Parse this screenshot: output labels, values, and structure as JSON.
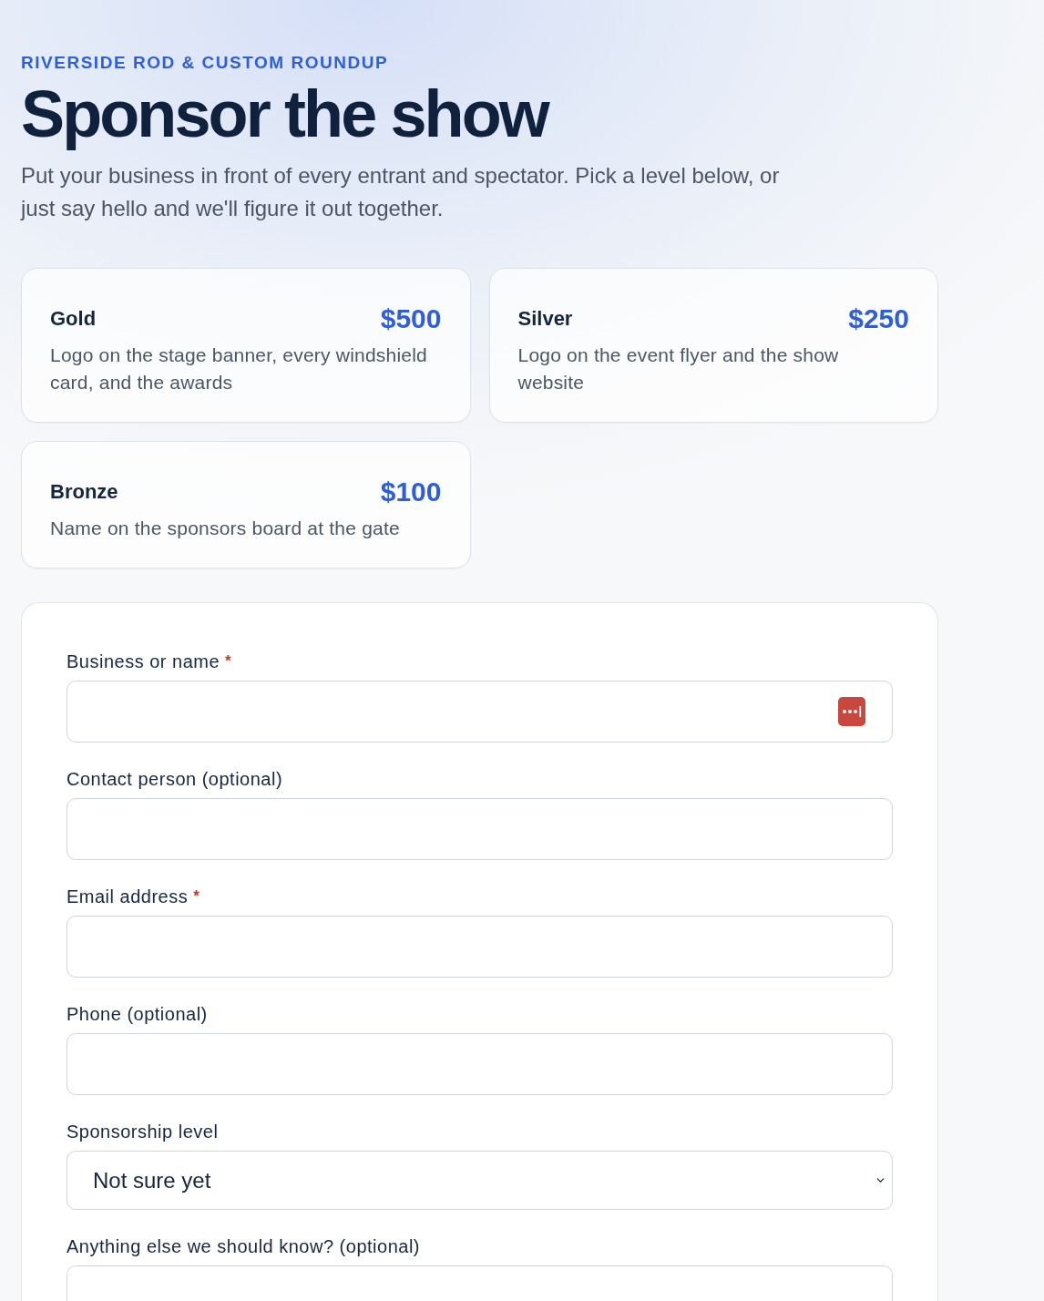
{
  "header": {
    "eyebrow": "RIVERSIDE ROD & CUSTOM ROUNDUP",
    "title": "Sponsor the show",
    "intro": "Put your business in front of every entrant and spectator. Pick a level below, or just say hello and we'll figure it out together."
  },
  "tiers": [
    {
      "name": "Gold",
      "price": "$500",
      "description": "Logo on the stage banner, every windshield card, and the awards"
    },
    {
      "name": "Silver",
      "price": "$250",
      "description": "Logo on the event flyer and the show website"
    },
    {
      "name": "Bronze",
      "price": "$100",
      "description": "Name on the sponsors board at the gate"
    }
  ],
  "form": {
    "required_marker": "*",
    "fields": [
      {
        "kind": "text",
        "label": "Business or name",
        "required": true,
        "autofill_icon": true
      },
      {
        "kind": "text",
        "label": "Contact person (optional)",
        "required": false,
        "autofill_icon": false
      },
      {
        "kind": "text",
        "label": "Email address",
        "required": true,
        "autofill_icon": false
      },
      {
        "kind": "text",
        "label": "Phone (optional)",
        "required": false,
        "autofill_icon": false
      },
      {
        "kind": "select",
        "label": "Sponsorship level",
        "required": false,
        "autofill_icon": false,
        "value": "Not sure yet"
      },
      {
        "kind": "textarea",
        "label": "Anything else we should know? (optional)",
        "required": false,
        "autofill_icon": false
      }
    ]
  }
}
